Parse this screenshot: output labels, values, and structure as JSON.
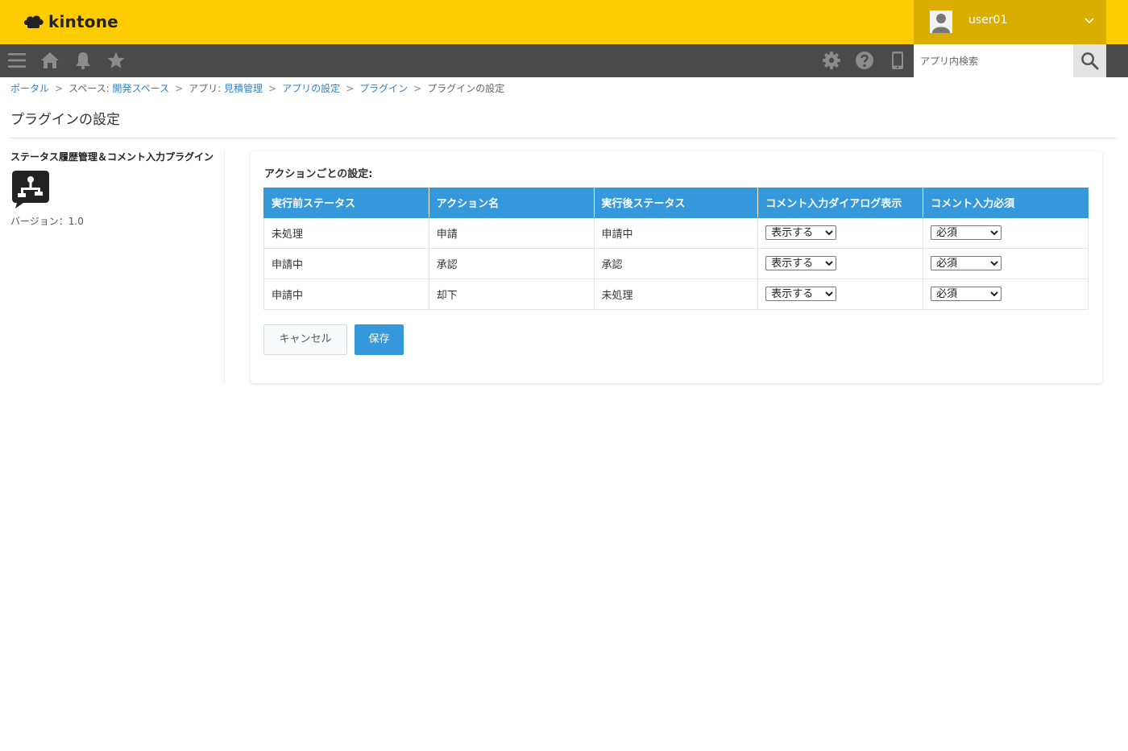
{
  "header": {
    "app_name": "kintone",
    "user_name": "user01",
    "icons": [
      "kintone-logo-icon",
      "avatar-icon",
      "chevron-down-icon"
    ]
  },
  "navbar": {
    "icons": [
      "menu-icon",
      "home-icon",
      "bell-icon",
      "star-icon",
      "gear-icon",
      "help-icon",
      "mobile-icon",
      "search-icon"
    ],
    "search_placeholder": "アプリ内検索"
  },
  "breadcrumb": {
    "portal": "ポータル",
    "space_prefix": "スペース: ",
    "space_name": "開発スペース",
    "app_prefix": "アプリ: ",
    "app_name": "見積管理",
    "app_settings": "アプリの設定",
    "plugins": "プラグイン",
    "current": "プラグインの設定",
    "separator": ">"
  },
  "page_title": "プラグインの設定",
  "plugin": {
    "name": "ステータス履歴管理＆コメント入力プラグイン",
    "version": "バージョン：1.0",
    "icon": "plugin-flow-icon"
  },
  "settings": {
    "section_label": "アクションごとの設定:",
    "columns": [
      "実行前ステータス",
      "アクション名",
      "実行後ステータス",
      "コメント入力ダイアログ表示",
      "コメント入力必須"
    ],
    "rows": [
      {
        "before": "未処理",
        "action": "申請",
        "after": "申請中",
        "dialog": "表示する",
        "required": "必須"
      },
      {
        "before": "申請中",
        "action": "承認",
        "after": "承認",
        "dialog": "表示する",
        "required": "必須"
      },
      {
        "before": "申請中",
        "action": "却下",
        "after": "未処理",
        "dialog": "表示する",
        "required": "必須"
      }
    ]
  },
  "buttons": {
    "cancel": "キャンセル",
    "save": "保存"
  },
  "colors": {
    "header_bg": "#ffcc00",
    "user_area_bg": "#d9ae00",
    "navbar_bg": "#4a4a4a",
    "accent": "#3498db",
    "link": "#2e82c6"
  }
}
